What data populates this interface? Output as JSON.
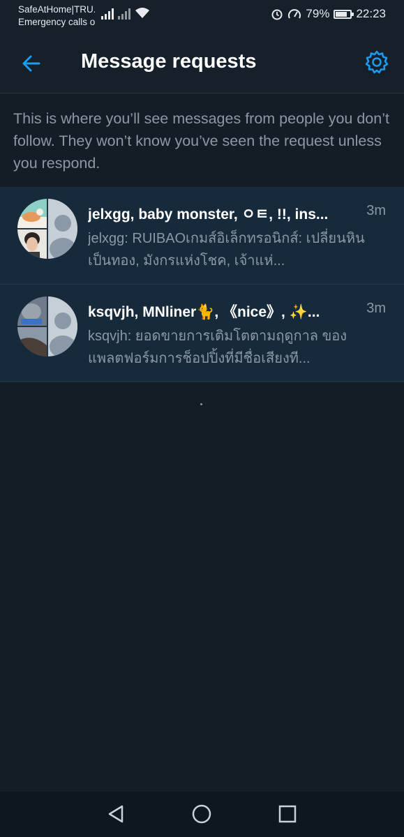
{
  "status_bar": {
    "carrier_line1": "SafeAtHome|TRU...",
    "carrier_line2": "Emergency calls o...",
    "battery_percent_text": "79%",
    "battery_level": 0.79,
    "time": "22:23",
    "icons": [
      "signal-icon",
      "no-signal-icon",
      "wifi-icon",
      "alarm-icon",
      "speed-icon",
      "battery-icon"
    ]
  },
  "header": {
    "title": "Message requests",
    "back_icon": "arrow-left-icon",
    "settings_icon": "gear-icon",
    "accent_color": "#1d9bf0"
  },
  "description": "This is where you’ll see messages from people you don’t follow. They won’t know you’ve seen the request unless you respond.",
  "requests": [
    {
      "names": "jelxgg, baby monster, ㅇㅌ, !!, ins...",
      "time": "3m",
      "preview": "jelxgg: RUIBAOเกมส์อิเล็กทรอนิกส์: เปลี่ยนหินเป็นทอง, มังกรแห่งโชค, เจ้าแห่..."
    },
    {
      "names": "ksqvjh, MNliner🐈, 《nice》, ✨...",
      "time": "3m",
      "preview": "ksqvjh: ยอดขายการเติมโตตามฤดูกาล ของแพลตฟอร์มการช็อปปิ้งที่มีชื่อเสียงที..."
    }
  ],
  "nav_bar": {
    "back_icon": "triangle-back-icon",
    "home_icon": "circle-home-icon",
    "recents_icon": "square-recents-icon"
  }
}
